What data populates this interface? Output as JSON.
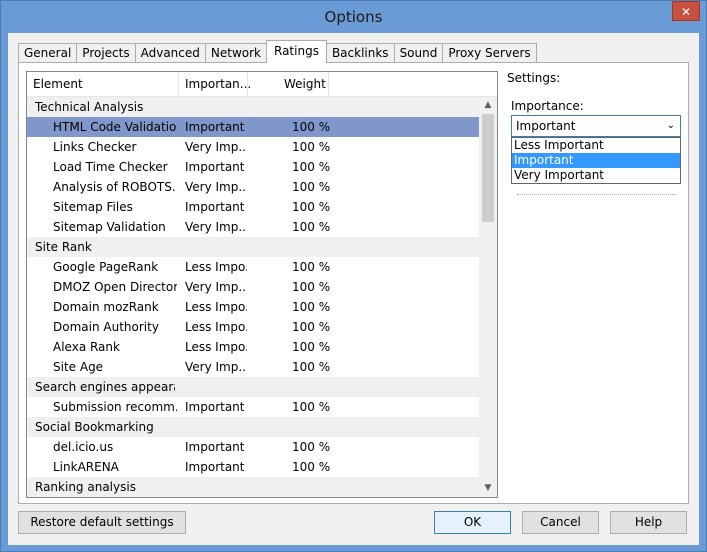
{
  "window": {
    "title": "Options",
    "close_icon": "✕"
  },
  "tabs": [
    "General",
    "Projects",
    "Advanced",
    "Network",
    "Ratings",
    "Backlinks",
    "Sound",
    "Proxy Servers"
  ],
  "active_tab_index": 4,
  "table": {
    "columns": [
      "Element",
      "Importan...",
      "Weight"
    ],
    "rows": [
      {
        "type": "group",
        "element": "Technical Analysis",
        "importance": "",
        "weight": ""
      },
      {
        "type": "child",
        "element": "HTML Code Validation",
        "importance": "Important",
        "weight": "100 %",
        "selected": true
      },
      {
        "type": "child",
        "element": "Links Checker",
        "importance": "Very Imp...",
        "weight": "100 %"
      },
      {
        "type": "child",
        "element": "Load Time Checker",
        "importance": "Important",
        "weight": "100 %"
      },
      {
        "type": "child",
        "element": "Analysis of ROBOTS....",
        "importance": "Very Imp...",
        "weight": "100 %"
      },
      {
        "type": "child",
        "element": "Sitemap Files",
        "importance": "Important",
        "weight": "100 %"
      },
      {
        "type": "child",
        "element": "Sitemap Validation",
        "importance": "Very Imp...",
        "weight": "100 %"
      },
      {
        "type": "group",
        "element": "Site Rank",
        "importance": "",
        "weight": ""
      },
      {
        "type": "child",
        "element": "Google PageRank",
        "importance": "Less Impo...",
        "weight": "100 %"
      },
      {
        "type": "child",
        "element": "DMOZ Open Directory",
        "importance": "Very Imp...",
        "weight": "100 %"
      },
      {
        "type": "child",
        "element": "Domain mozRank",
        "importance": "Less Impo...",
        "weight": "100 %"
      },
      {
        "type": "child",
        "element": "Domain Authority",
        "importance": "Less Impo...",
        "weight": "100 %"
      },
      {
        "type": "child",
        "element": "Alexa Rank",
        "importance": "Less Impo...",
        "weight": "100 %"
      },
      {
        "type": "child",
        "element": "Site Age",
        "importance": "Very Imp...",
        "weight": "100 %"
      },
      {
        "type": "group",
        "element": "Search engines appeara...",
        "importance": "",
        "weight": ""
      },
      {
        "type": "child",
        "element": "Submission recomm...",
        "importance": "Important",
        "weight": "100 %"
      },
      {
        "type": "group",
        "element": "Social Bookmarking",
        "importance": "",
        "weight": ""
      },
      {
        "type": "child",
        "element": "del.icio.us",
        "importance": "Important",
        "weight": "100 %"
      },
      {
        "type": "child",
        "element": "LinkARENA",
        "importance": "Important",
        "weight": "100 %"
      },
      {
        "type": "group",
        "element": "Ranking analysis",
        "importance": "",
        "weight": ""
      }
    ]
  },
  "settings": {
    "label": "Settings:",
    "importance_label": "Importance:",
    "selected_value": "Important",
    "options": [
      "Less Important",
      "Important",
      "Very Important"
    ],
    "highlighted_option_index": 1
  },
  "buttons": {
    "restore": "Restore default settings",
    "ok": "OK",
    "cancel": "Cancel",
    "help": "Help"
  },
  "icons": {
    "scroll_up": "▲",
    "scroll_down": "▼",
    "chevron_down": "⌄"
  }
}
